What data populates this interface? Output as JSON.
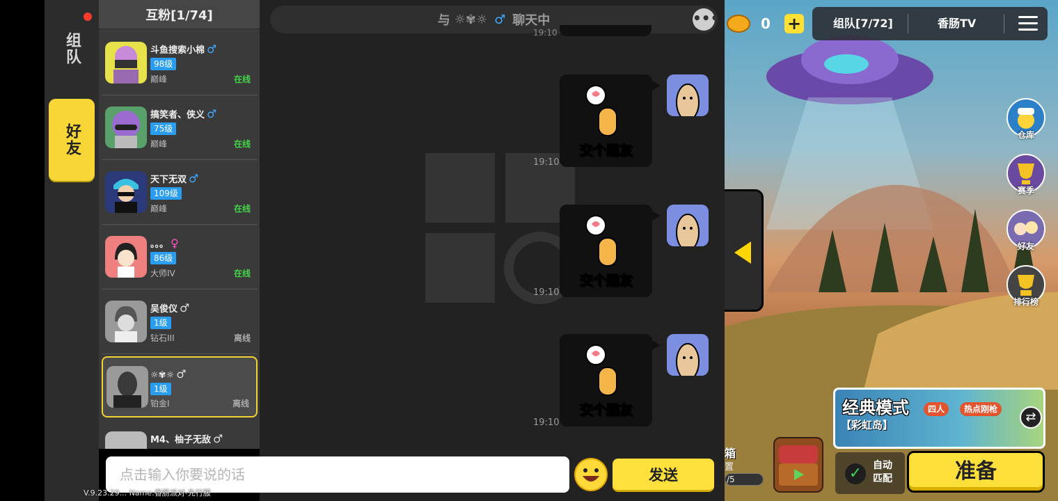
{
  "rail": {
    "tabs": [
      {
        "label": "组队",
        "selected": false
      },
      {
        "label": "好友",
        "selected": true
      }
    ]
  },
  "friend_list": {
    "header": "互粉[1/74]",
    "friends": [
      {
        "name": "斗鱼搜索小棉",
        "gender": "♂",
        "level": "98级",
        "rank": "巅峰",
        "status": "在线"
      },
      {
        "name": "搞笑者、侠义",
        "gender": "♂",
        "level": "75级",
        "rank": "巅峰",
        "status": "在线"
      },
      {
        "name": "天下无双",
        "gender": "♂",
        "level": "109级",
        "rank": "巅峰",
        "status": "在线"
      },
      {
        "name": "。。。",
        "gender": "♀",
        "level": "86级",
        "rank": "大师IV",
        "status": "在线"
      },
      {
        "name": "吴俊仪",
        "gender": "♂",
        "level": "1级",
        "rank": "钻石III",
        "status": "离线"
      },
      {
        "name": "☼✾☼",
        "gender": "♂",
        "level": "1级",
        "rank": "铂金I",
        "status": "离线",
        "selected": true
      },
      {
        "name": "M4、柚子无敌",
        "gender": "♂",
        "level": "",
        "rank": "",
        "status": ""
      }
    ]
  },
  "chat": {
    "header_prefix": "与",
    "header_name": "☼✾☼",
    "header_gender": "♂",
    "header_suffix": "聊天中",
    "more_icon": "•••",
    "top_time": "19:10",
    "messages": [
      {
        "time": "19:10",
        "sticker_text": "交个朋友"
      },
      {
        "time": "19:10",
        "sticker_text": "交个朋友"
      },
      {
        "time": "19:10",
        "sticker_text": "交个朋友"
      }
    ]
  },
  "input": {
    "placeholder": "点击输入你要说的话",
    "send_label": "发送"
  },
  "version_text": "V.9.23.29... Name:香肠派对-先行服",
  "game": {
    "coin_count": "0",
    "coin_plus": "+",
    "team_label": "组队[7/72]",
    "tv_label": "香肠TV",
    "side_buttons": [
      {
        "label": "仓库",
        "icon": "warehouse-icon"
      },
      {
        "label": "赛季",
        "icon": "season-trophy-icon"
      },
      {
        "label": "好友",
        "icon": "friends-icon"
      },
      {
        "label": "排行榜",
        "icon": "leaderboard-icon"
      }
    ],
    "mode_title": "经典模式",
    "mode_map": "【彩虹岛】",
    "mode_badges": [
      "四人",
      "热点刚枪"
    ],
    "swap_icon": "⇄",
    "box_label": "箱",
    "box_sub": "置",
    "box_progress": "/5",
    "auto_match": "自动匹配",
    "auto_check": "✓",
    "ready_label": "准备"
  },
  "colors": {
    "accent_yellow": "#ffe03b",
    "online_green": "#45d34a",
    "level_blue": "#2a9df0",
    "male_blue": "#3fa9ff",
    "female_pink": "#ff52c8"
  }
}
